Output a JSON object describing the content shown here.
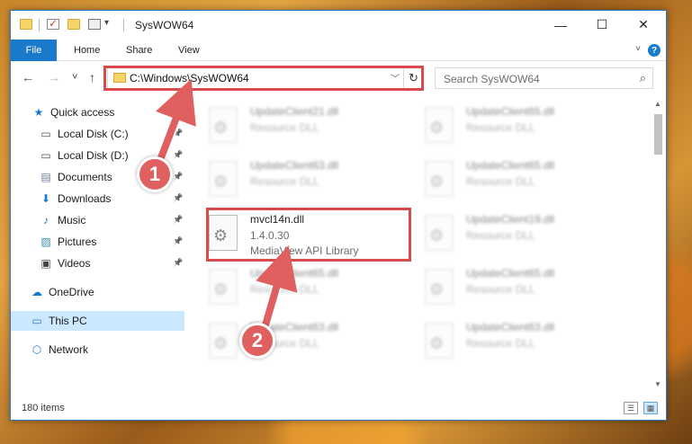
{
  "window": {
    "title": "SysWOW64",
    "controls": {
      "minimize": "—",
      "maximize": "☐",
      "close": "✕"
    }
  },
  "ribbon": {
    "file": "File",
    "tabs": [
      "Home",
      "Share",
      "View"
    ],
    "help": "?"
  },
  "nav": {
    "back": "←",
    "forward": "→",
    "recent": "˅",
    "up": "↑",
    "address": "C:\\Windows\\SysWOW64",
    "search_placeholder": "Search SysWOW64"
  },
  "sidebar": {
    "items": [
      {
        "label": "Quick access",
        "icon": "star-icon",
        "pinned": false
      },
      {
        "label": "Local Disk (C:)",
        "icon": "drive-icon",
        "pinned": true
      },
      {
        "label": "Local Disk (D:)",
        "icon": "drive-icon",
        "pinned": true
      },
      {
        "label": "Documents",
        "icon": "documents-icon",
        "pinned": true
      },
      {
        "label": "Downloads",
        "icon": "download-icon",
        "pinned": true
      },
      {
        "label": "Music",
        "icon": "music-icon",
        "pinned": true
      },
      {
        "label": "Pictures",
        "icon": "pictures-icon",
        "pinned": true
      },
      {
        "label": "Videos",
        "icon": "videos-icon",
        "pinned": true
      },
      {
        "label": "OneDrive",
        "icon": "cloud-icon",
        "pinned": false
      },
      {
        "label": "This PC",
        "icon": "computer-icon",
        "pinned": false,
        "selected": true
      },
      {
        "label": "Network",
        "icon": "network-icon",
        "pinned": false
      }
    ]
  },
  "files": [
    {
      "name": "UpdateClient21.dll",
      "line1": "Resource DLL",
      "line2": ""
    },
    {
      "name": "UpdateClient65.dll",
      "line1": "Resource DLL",
      "line2": ""
    },
    {
      "name": "UpdateClient63.dll",
      "line1": "Resource DLL",
      "line2": ""
    },
    {
      "name": "UpdateClient65.dll",
      "line1": "Resource DLL",
      "line2": ""
    },
    {
      "name": "mvcl14n.dll",
      "line1": "1.4.0.30",
      "line2": "MediaView API Library"
    },
    {
      "name": "UpdateClient19.dll",
      "line1": "Resource DLL",
      "line2": ""
    },
    {
      "name": "UpdateClient65.dll",
      "line1": "Resource DLL",
      "line2": ""
    },
    {
      "name": "UpdateClient65.dll",
      "line1": "Resource DLL",
      "line2": ""
    },
    {
      "name": "UpdateClient63.dll",
      "line1": "Resource DLL",
      "line2": ""
    },
    {
      "name": "UpdateClient63.dll",
      "line1": "Resource DLL",
      "line2": ""
    }
  ],
  "status": {
    "count": "180 items"
  },
  "callouts": {
    "one": "1",
    "two": "2"
  },
  "colors": {
    "accent": "#1979ca",
    "highlight": "#d94b4b",
    "callout": "#e06060",
    "selected": "#cce8ff"
  }
}
